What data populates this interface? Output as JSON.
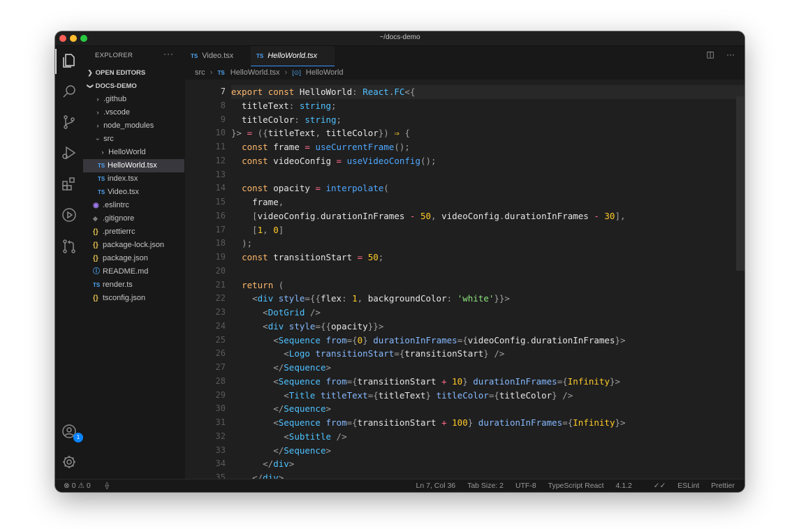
{
  "window": {
    "title": "~/docs-demo"
  },
  "activity_bar": {
    "icons": [
      "files-icon",
      "search-icon",
      "source-control-icon",
      "run-debug-icon",
      "extensions-icon",
      "play-icon",
      "pull-request-icon"
    ],
    "account_badge": "1",
    "bottom_icons": [
      "account-icon",
      "settings-gear-icon"
    ]
  },
  "sidebar": {
    "header": "EXPLORER",
    "more": "···",
    "open_editors": "OPEN EDITORS",
    "project": "DOCS-DEMO",
    "items": [
      {
        "label": ".github",
        "kind": "folder"
      },
      {
        "label": ".vscode",
        "kind": "folder"
      },
      {
        "label": "node_modules",
        "kind": "folder"
      },
      {
        "label": "src",
        "kind": "folder-open"
      },
      {
        "label": "HelloWorld",
        "kind": "folder"
      },
      {
        "label": "HelloWorld.tsx",
        "kind": "ts",
        "selected": true
      },
      {
        "label": "index.tsx",
        "kind": "ts"
      },
      {
        "label": "Video.tsx",
        "kind": "ts"
      },
      {
        "label": ".eslintrc",
        "kind": "eslint"
      },
      {
        "label": ".gitignore",
        "kind": "git"
      },
      {
        "label": ".prettierrc",
        "kind": "json"
      },
      {
        "label": "package-lock.json",
        "kind": "json"
      },
      {
        "label": "package.json",
        "kind": "json"
      },
      {
        "label": "README.md",
        "kind": "info"
      },
      {
        "label": "render.ts",
        "kind": "ts"
      },
      {
        "label": "tsconfig.json",
        "kind": "json"
      }
    ]
  },
  "tabs": [
    {
      "label": "Video.tsx",
      "icon": "TS",
      "active": false
    },
    {
      "label": "HelloWorld.tsx",
      "icon": "TS",
      "active": true
    }
  ],
  "breadcrumb": {
    "parts": [
      "src",
      "HelloWorld.tsx",
      "HelloWorld"
    ],
    "ts_icon": "TS",
    "symbol_icon": "[⊙]"
  },
  "editor": {
    "current_line": 7,
    "line_numbers": [
      "7",
      "8",
      "9",
      "10",
      "11",
      "12",
      "13",
      "14",
      "15",
      "16",
      "17",
      "18",
      "19",
      "20",
      "21",
      "22",
      "23",
      "24",
      "25",
      "26",
      "27",
      "28",
      "29",
      "30",
      "31",
      "32",
      "33",
      "34",
      "35"
    ]
  },
  "status_bar": {
    "errors": "0",
    "warnings": "0",
    "position": "Ln 7, Col 36",
    "tab_size": "Tab Size: 2",
    "encoding": "UTF-8",
    "language": "TypeScript React",
    "version": "4.1.2",
    "eslint": "ESLint",
    "prettier": "Prettier"
  },
  "colors": {
    "editor_bg": "#1f1f1f",
    "sidebar_bg": "#181818",
    "accent": "#3794ff",
    "keyword": "#ffb86c",
    "type": "#4fc1ff",
    "number": "#ffca28",
    "string": "#8ee57e"
  }
}
